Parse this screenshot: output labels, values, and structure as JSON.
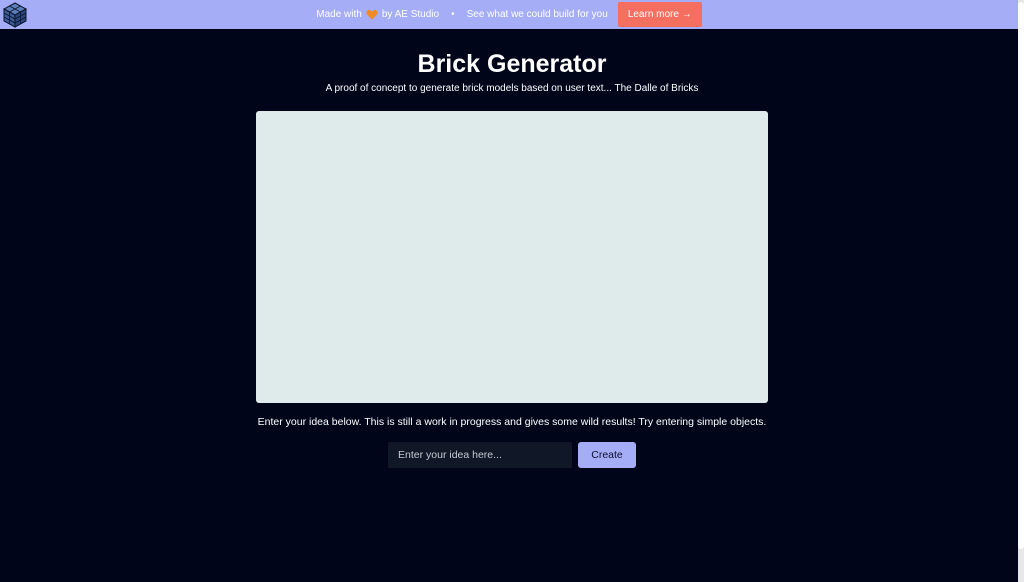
{
  "banner": {
    "made_with_prefix": "Made with",
    "heart_icon": "orange-heart-icon",
    "made_with_suffix": "by AE Studio",
    "separator": "•",
    "tagline": "See what we could build for you",
    "learn_more_label": "Learn more →",
    "background_color": "#a5adf7",
    "button_color": "#f46f5f"
  },
  "logo": {
    "icon": "brick-cube-logo-icon"
  },
  "page": {
    "title": "Brick Generator",
    "subtitle": "A proof of concept to generate brick models based on user text... The Dalle of Bricks",
    "hint": "Enter your idea below. This is still a work in progress and gives some wild results! Try entering simple objects.",
    "background_color": "#01051a"
  },
  "canvas": {
    "background_color": "#dfebea"
  },
  "form": {
    "input_value": "",
    "input_placeholder": "Enter your idea here...",
    "create_label": "Create",
    "button_color": "#a5adf7"
  }
}
